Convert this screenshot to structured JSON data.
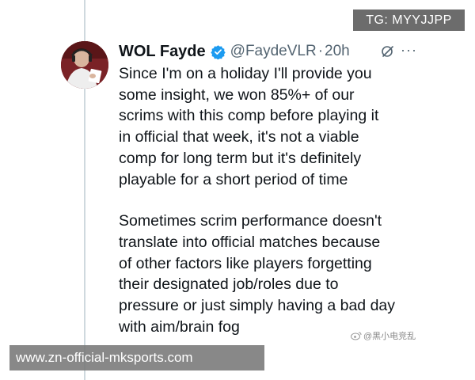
{
  "tweet": {
    "author_name": "WOL Fayde",
    "handle": "@FaydeVLR",
    "separator": "·",
    "time": "20h",
    "text_lines": [
      "Since I'm on a holiday I'll provide you",
      "some insight, we won 85%+ of our",
      "scrims with this comp before playing it",
      "in official that week, it's not a viable",
      "comp for long term but it's definitely",
      "playable for a short period of time",
      "Sometimes scrim performance doesn't",
      "translate into official matches because",
      "of other factors like players forgetting",
      "their designated job/roles due to",
      "pressure or just simply having a bad day",
      "with aim/brain fog"
    ],
    "more_label": "···"
  },
  "overlays": {
    "tg_label": "TG: MYYJJPP",
    "site_label": "www.zn-official-mksports.com",
    "weibo_label": "@黑小电竞乱"
  },
  "icons": {
    "verified": "verified-badge-icon",
    "grok": "grok-icon",
    "more": "more-options-icon",
    "weibo": "weibo-icon"
  },
  "colors": {
    "verified_blue": "#1d9bf0",
    "text": "#0f1419",
    "secondary_text": "#536471",
    "thread_line": "#cfd9de",
    "avatar_bg": "#6e1f22"
  }
}
